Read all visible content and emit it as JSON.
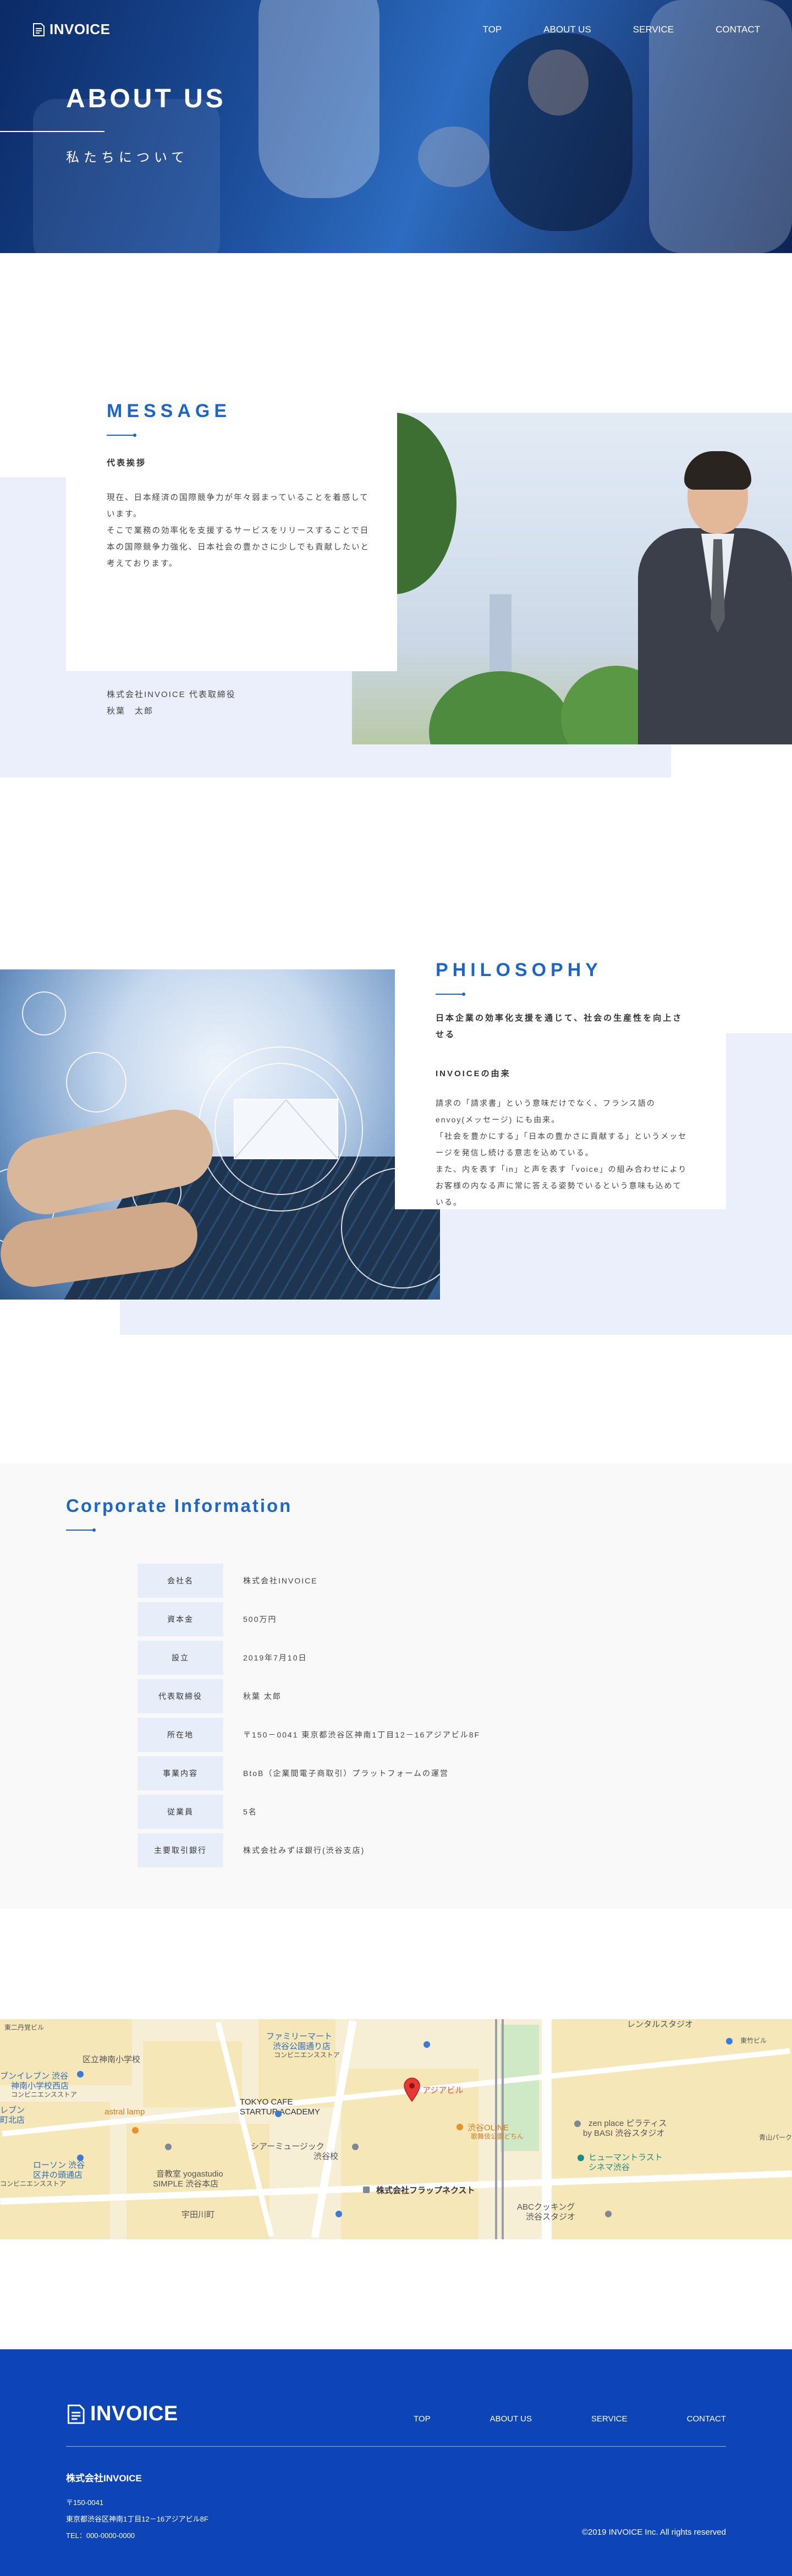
{
  "brand": {
    "name": "INVOICE",
    "logo_icon": "invoice-document-icon"
  },
  "nav": {
    "items": [
      "TOP",
      "ABOUT US",
      "SERVICE",
      "CONTACT"
    ]
  },
  "hero": {
    "title": "ABOUT US",
    "subtitle": "私たちについて"
  },
  "message": {
    "heading": "MESSAGE",
    "role": "代表挨拶",
    "body": "現在、日本経済の国際競争力が年々弱まっていることを着感しています。\nそこで業務の効率化を支援するサービスをリリースすることで日本の国際競争力強化、日本社会の豊かさに少しでも貢献したいと考えております。",
    "sign_company": "株式会社INVOICE 代表取締役",
    "sign_name": "秋葉　太郎"
  },
  "philosophy": {
    "heading": "PHILOSOPHY",
    "lead": "日本企業の効率化支援を通じて、社会の生産性を向上させる",
    "sub_title": "INVOICEの由来",
    "body": "請求の「請求書」という意味だけでなく、フランス語の envoy(メッセージ) にも由来。\n「社会を豊かにする」「日本の豊かさに貢献する」というメッセージを発信し続ける意志を込めている。\nまた、内を表す「in」と声を表す「voice」の組み合わせによりお客様の内なる声に常に答える姿勢でいるという意味も込めている。"
  },
  "corporate": {
    "heading": "Corporate Information",
    "rows": [
      {
        "label": "会社名",
        "value": "株式会社INVOICE"
      },
      {
        "label": "資本金",
        "value": "500万円"
      },
      {
        "label": "設立",
        "value": "2019年7月10日"
      },
      {
        "label": "代表取締役",
        "value": "秋葉 太郎"
      },
      {
        "label": "所在地",
        "value": "〒150－0041 東京都渋谷区神南1丁目12－16アジアビル8F"
      },
      {
        "label": "事業内容",
        "value": "BtoB（企業間電子商取引）プラットフォームの運営"
      },
      {
        "label": "従業員",
        "value": "5名"
      },
      {
        "label": "主要取引銀行",
        "value": "株式会社みずほ銀行(渋谷支店)"
      }
    ]
  },
  "map": {
    "labels": {
      "l1": "東二丹覚ビル",
      "l2": "区立神南小学校",
      "l3": "ブンイレブン 渋谷",
      "l4": "神南小学校西店",
      "l5": "コンビニエンスストア",
      "l6": "レブン",
      "l7": "町北店",
      "l8": "astral lamp",
      "l9": "ローソン 渋谷",
      "l10": "区井の頭通店",
      "l11": "コンビニエンスストア",
      "l12": "ファミリーマート",
      "l13": "渋谷公園通り店",
      "l14": "コンビニエンスストア",
      "l15": "TOKYO CAFE",
      "l16": "STARTUP ACADEMY",
      "l17": "シアーミュージック",
      "l18": "渋谷校",
      "l19": "音教室 yogastudio",
      "l20": "SIMPLE 渋谷本店",
      "l21": "宇田川町",
      "l22": "アジアビル",
      "l23": "渋谷OLINE",
      "l24": "歌舞伎公園どちん",
      "l25": "株式会社フラップネクスト",
      "l26": "zen place ピラティス",
      "l27": "by BASI 渋谷スタジオ",
      "l28": "ヒューマントラスト",
      "l29": "シネマ渋谷",
      "l30": "ABCクッキング",
      "l31": "渋谷スタジオ",
      "l32": "レンタルスタジオ",
      "l33": "東竹ビル",
      "l34": "青山パーク"
    }
  },
  "footer": {
    "nav": [
      "TOP",
      "ABOUT US",
      "SERVICE",
      "CONTACT"
    ],
    "company": "株式会社INVOICE",
    "postal": "〒150-0041",
    "address": "東京都渋谷区神南1丁目12－16アジアビル8F",
    "tel": "TEL：000-0000-0000",
    "copyright": "©2019 INVOICE Inc. All rights reserved"
  },
  "colors": {
    "accent": "#1c66c9",
    "tint": "#eaeffb",
    "footer": "#0d44b8",
    "label_bg": "#e7edf9"
  }
}
